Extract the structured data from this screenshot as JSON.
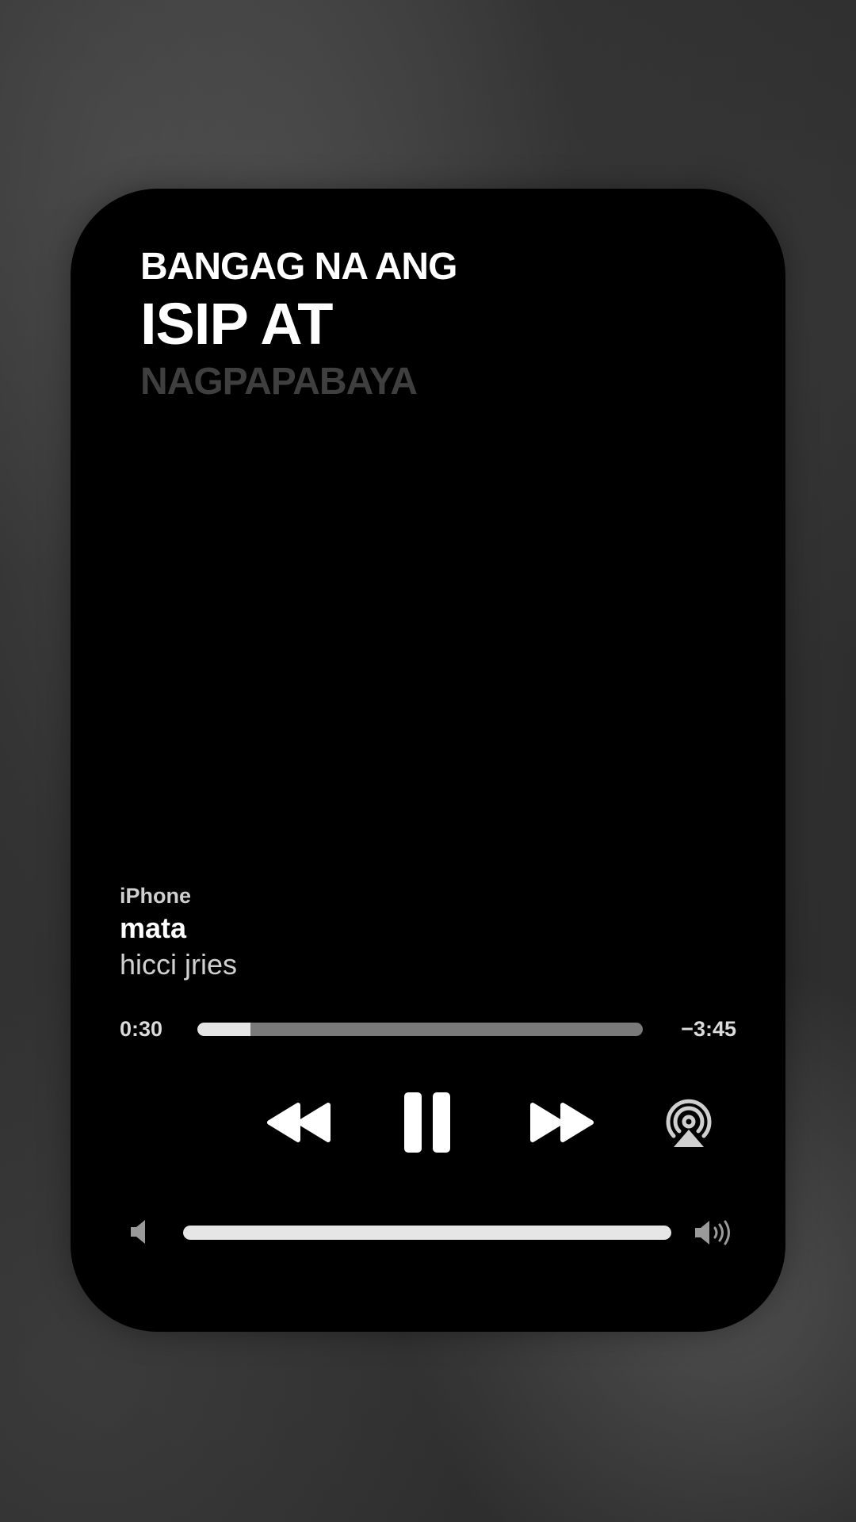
{
  "lyrics": {
    "line1": "BANGAG NA ANG",
    "line2": "ISIP AT",
    "line3": "NAGPAPABAYA"
  },
  "now_playing": {
    "device": "iPhone",
    "title": "mata",
    "artist": "hicci jries"
  },
  "progress": {
    "elapsed": "0:30",
    "remaining": "−3:45",
    "fraction": 0.12
  },
  "volume": {
    "fraction": 1.0
  },
  "icons": {
    "rewind": "rewind-icon",
    "pause": "pause-icon",
    "forward": "fast-forward-icon",
    "airplay": "airplay-icon",
    "volume_low": "speaker-low-icon",
    "volume_high": "speaker-high-icon"
  },
  "colors": {
    "card_background": "#000000",
    "lyric_active": "#ffffff",
    "lyric_upcoming": "#3f3f3f",
    "progress_fill": "#e5e5e5",
    "progress_track": "#7a7a7a"
  }
}
